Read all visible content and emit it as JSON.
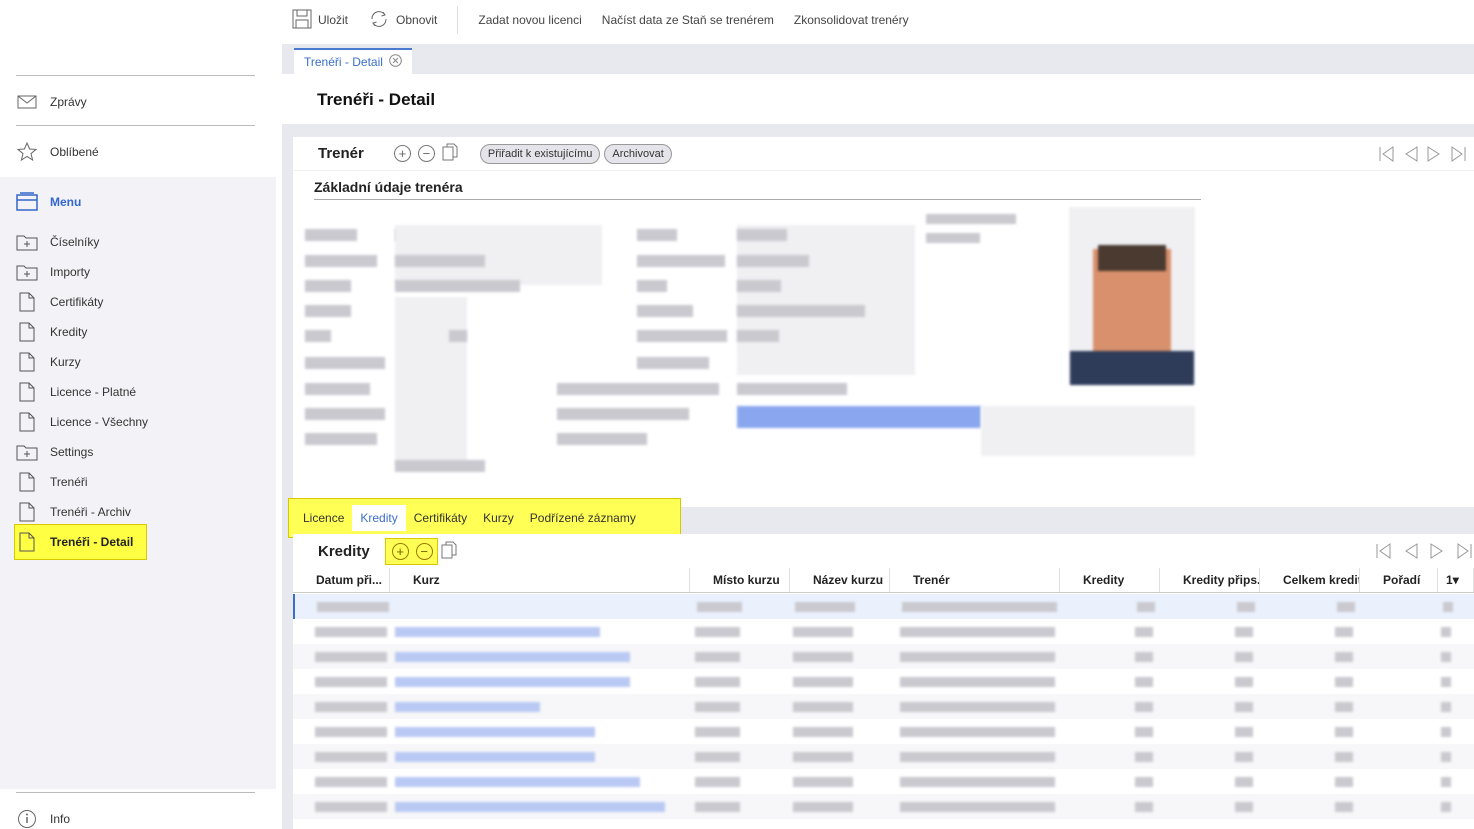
{
  "toolbar": {
    "save": "Uložit",
    "refresh": "Obnovit",
    "new_license": "Zadat novou licenci",
    "load_data": "Načíst data ze Staň se trenérem",
    "consolidate": "Zkonsolidovat trenéry"
  },
  "sidebar": {
    "messages": "Zprávy",
    "favorites": "Oblíbené",
    "menu": "Menu",
    "items": [
      {
        "label": "Číselníky",
        "icon": "folder-plus-icon"
      },
      {
        "label": "Importy",
        "icon": "folder-plus-icon"
      },
      {
        "label": "Certifikáty",
        "icon": "document-icon"
      },
      {
        "label": "Kredity",
        "icon": "document-icon"
      },
      {
        "label": "Kurzy",
        "icon": "document-icon"
      },
      {
        "label": "Licence - Platné",
        "icon": "document-icon"
      },
      {
        "label": "Licence - Všechny",
        "icon": "document-icon"
      },
      {
        "label": "Settings",
        "icon": "folder-plus-icon"
      },
      {
        "label": "Trenéři",
        "icon": "document-icon"
      },
      {
        "label": "Trenéři - Archiv",
        "icon": "document-icon"
      },
      {
        "label": "Trenéři - Detail",
        "icon": "document-icon"
      }
    ],
    "info": "Info"
  },
  "tab": {
    "label": "Trenéři - Detail"
  },
  "page_title": "Trenéři - Detail",
  "trainer_section": {
    "title": "Trenér",
    "assign_button": "Přiřadit k existujícímu",
    "archive_button": "Archivovat",
    "basic_info_title": "Základní údaje trenéra"
  },
  "lower_tabs": [
    "Licence",
    "Kredity",
    "Certifikáty",
    "Kurzy",
    "Podřízené záznamy"
  ],
  "credits_section": {
    "title": "Kredity",
    "columns": [
      "Datum při...",
      "Kurz",
      "Místo kurzu",
      "Název kurzu",
      "Trenér",
      "Kredity",
      "Kredity přips...",
      "Celkem kreditů",
      "Pořadí",
      "1"
    ]
  },
  "colors": {
    "accent": "#3a6fc9",
    "highlight": "#ffff44"
  }
}
